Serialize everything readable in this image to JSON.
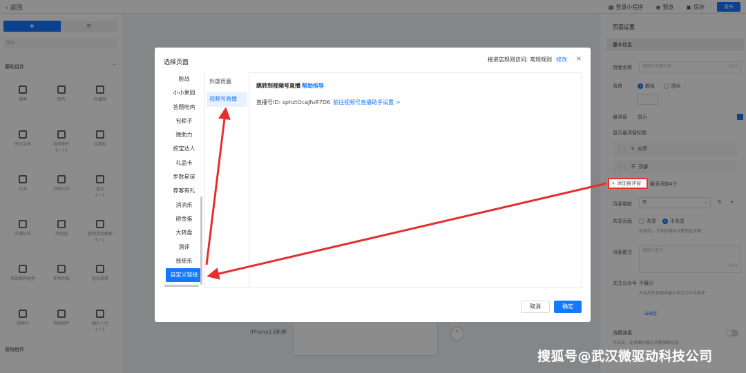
{
  "topbar": {
    "back_label": "返回",
    "actions": [
      {
        "label": "登录小程序",
        "icon": "mini-program-icon"
      },
      {
        "label": "预览",
        "icon": "eye-icon"
      },
      {
        "label": "保存",
        "icon": "save-icon"
      }
    ],
    "publish_label": "发布"
  },
  "left_panel": {
    "search_placeholder": "搜索",
    "group_basic": "基础组件",
    "group_other": "营销组件",
    "components": [
      {
        "label": "搜索"
      },
      {
        "label": "图片"
      },
      {
        "label": "轮播图"
      },
      {
        "label": "图文导航"
      },
      {
        "label": "视频图片",
        "sub": "0 / 10"
      },
      {
        "label": "标题栏"
      },
      {
        "label": "文本"
      },
      {
        "label": "分隔占位"
      },
      {
        "label": "富文",
        "sub": "0 / 1"
      },
      {
        "label": "店铺公告"
      },
      {
        "label": "商品组"
      },
      {
        "label": "营销活动模板",
        "sub": "0 / 1"
      },
      {
        "label": "商家推荐组件"
      },
      {
        "label": "专场列表"
      },
      {
        "label": "会员菜单"
      },
      {
        "label": "视频号"
      },
      {
        "label": "视频组件"
      },
      {
        "label": "图片人生",
        "sub": "0 / 1"
      }
    ]
  },
  "canvas": {
    "device_label": "iPhone13新屏"
  },
  "right_panel": {
    "title": "页面设置",
    "section_basic": "基本信息",
    "page_name_label": "页面名称",
    "page_name_placeholder": "请填写页面名称",
    "page_name_count": "0/16",
    "bg_label": "背景",
    "bg_option_color": "颜色",
    "bg_option_image": "图片",
    "float_label": "悬浮窗",
    "float_value": "显示",
    "menu_title": "显示悬浮窗标题",
    "menu_items": [
      "分享",
      "顶部"
    ],
    "add_menu_label": "添加悬浮窗",
    "add_menu_hint": "最多添加4个",
    "page_nav_label": "页面导航",
    "page_nav_value": "无",
    "share_label": "共享页面",
    "share_option_a": "共享",
    "share_option_b": "不共享",
    "share_hint": "共享后，下级店铺可以使用此页面",
    "remark_label": "页面备注",
    "remark_placeholder": "请填写备注",
    "remark_count": "0/50",
    "official_label": "关注公众号",
    "official_value": "不展示",
    "official_hint": "开启后在页面中展示关注公众号组件",
    "official_link": "去绑定",
    "subscribe_label": "消费弹幕",
    "subscribe_hint": "开启后，在页面中展示消费弹幕信息"
  },
  "modal": {
    "title": "选择页面",
    "rule_text": "接进店规则访问: 常规规则",
    "rule_edit": "修改",
    "close_label": "×",
    "categories": [
      "脸战",
      "小小果园",
      "答题吃鸡",
      "包粽子",
      "微助力",
      "挖宝达人",
      "礼品卡",
      "步数星球",
      "荐客有礼",
      "消消乐",
      "砸金蛋",
      "大转盘",
      "测评",
      "摇摇乐",
      "自定义链接"
    ],
    "active_category": 14,
    "subtypes": [
      "外部页面",
      "视频号直播"
    ],
    "active_subtype": 1,
    "detail_heading": "跳转到视频号直播",
    "detail_help": "帮助指导",
    "detail_id_label": "直播号ID: sphztOcaJfuR7D6",
    "detail_id_link": "前往视频号直播助手设置 >",
    "cancel_label": "取消",
    "ok_label": "确定"
  },
  "watermark": "搜狐号@武汉微驱动科技公司",
  "colors": {
    "primary": "#1677ff",
    "annotation": "#e62e2e",
    "overlay": "rgba(0,0,0,0.45)"
  }
}
